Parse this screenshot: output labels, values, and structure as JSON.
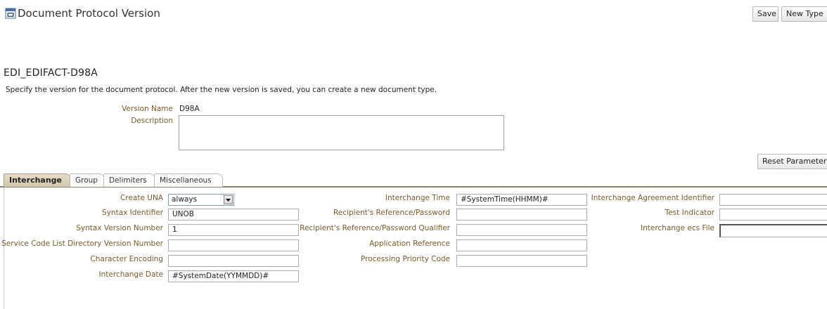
{
  "header": {
    "title": "Document Protocol Version",
    "icon": "document-calendar-icon",
    "buttons": {
      "save": "Save",
      "new_type": "New Type"
    }
  },
  "document": {
    "name": "EDI_EDIFACT-D98A",
    "instructions": "Specify the version for the document protocol. After the new version is saved, you can create a new document type."
  },
  "form": {
    "version_name_label": "Version Name",
    "version_name_value": "D98A",
    "description_label": "Description",
    "description_value": "",
    "reset_button": "Reset Parameter"
  },
  "tabs": [
    {
      "label": "Interchange",
      "active": true
    },
    {
      "label": "Group",
      "active": false
    },
    {
      "label": "Delimiters",
      "active": false
    },
    {
      "label": "Miscellaneous",
      "active": false
    }
  ],
  "interchange": {
    "col1": [
      {
        "label": "Create UNA",
        "value": "always",
        "type": "select"
      },
      {
        "label": "Syntax Identifier",
        "value": "UNOB"
      },
      {
        "label": "Syntax Version Number",
        "value": "1"
      },
      {
        "label": "Service Code List Directory Version Number",
        "value": ""
      },
      {
        "label": "Character Encoding",
        "value": ""
      },
      {
        "label": "Interchange Date",
        "value": "#SystemDate(YYMMDD)#"
      }
    ],
    "col2": [
      {
        "label": "Interchange Time",
        "value": "#SystemTime(HHMM)#"
      },
      {
        "label": "Recipient's Reference/Password",
        "value": ""
      },
      {
        "label": "Recipient's Reference/Password Qualifier",
        "value": ""
      },
      {
        "label": "Application Reference",
        "value": ""
      },
      {
        "label": "Processing Priority Code",
        "value": ""
      }
    ],
    "col3": [
      {
        "label": "Interchange Agreement Identifier",
        "value": ""
      },
      {
        "label": "Test Indicator",
        "value": ""
      },
      {
        "label": "Interchange ecs File",
        "value": ""
      }
    ]
  },
  "colors": {
    "label": "#7a5a2a",
    "tab_active": "#d2c6ac",
    "tab_rule": "#8d8169"
  }
}
